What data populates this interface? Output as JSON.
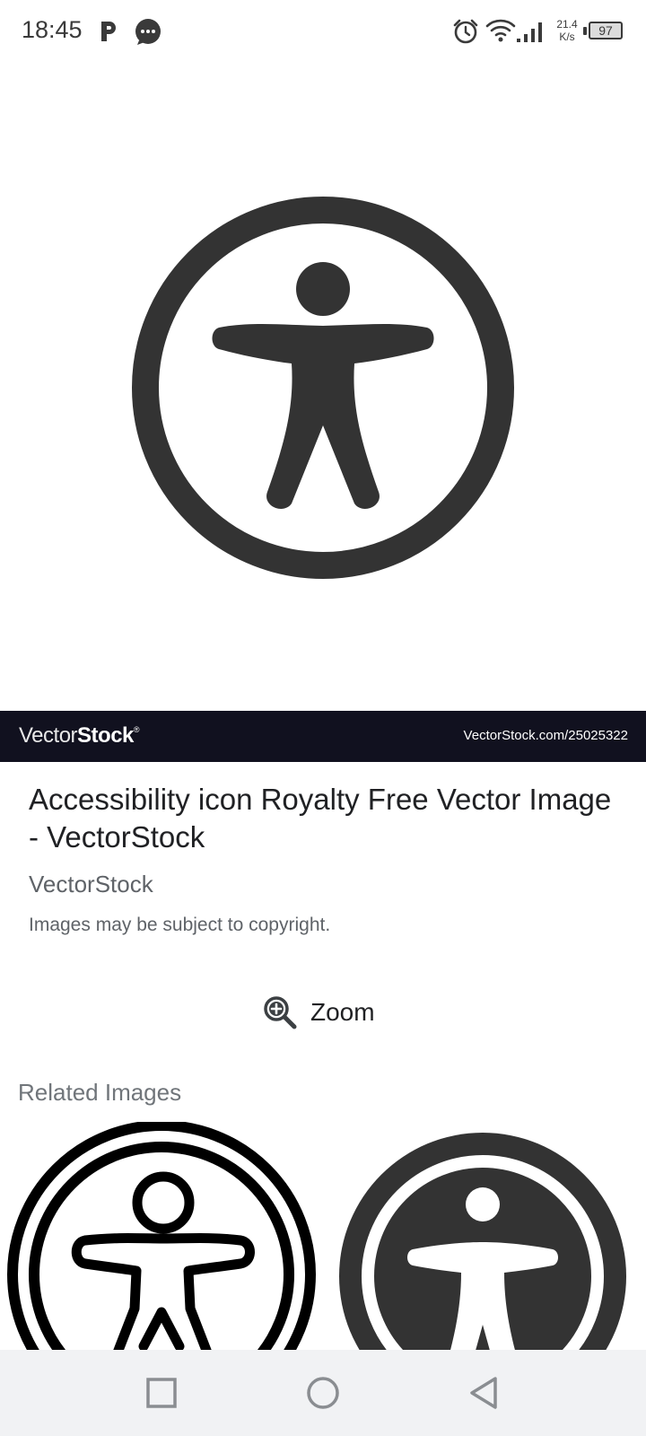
{
  "status_bar": {
    "time": "18:45",
    "net_speed_value": "21.4",
    "net_speed_unit": "K/s",
    "battery": "97",
    "icons": [
      "parking-icon",
      "message-bubble-icon",
      "alarm-icon",
      "wifi-icon",
      "cell-signal-icon",
      "battery-icon"
    ]
  },
  "watermark": {
    "brand_light": "Vector",
    "brand_bold": "Stock",
    "brand_reg": "®",
    "image_id": "VectorStock.com/25025322"
  },
  "details": {
    "title": "Accessibility icon Royalty Free Vector Image - VectorStock",
    "source": "VectorStock",
    "copyright_notice": "Images may be subject to copyright."
  },
  "zoom": {
    "label": "Zoom",
    "icon": "zoom-in-icon"
  },
  "related": {
    "heading": "Related Images",
    "items": [
      {
        "icon": "accessibility-outline-icon"
      },
      {
        "icon": "accessibility-filled-icon"
      }
    ]
  },
  "navigation": {
    "buttons": [
      "recents-button",
      "home-button",
      "back-button"
    ]
  },
  "colors": {
    "icon_dark": "#333333",
    "watermark_bg": "#11111f",
    "nav_bg": "#f1f2f4",
    "secondary_text": "#5f6368"
  }
}
